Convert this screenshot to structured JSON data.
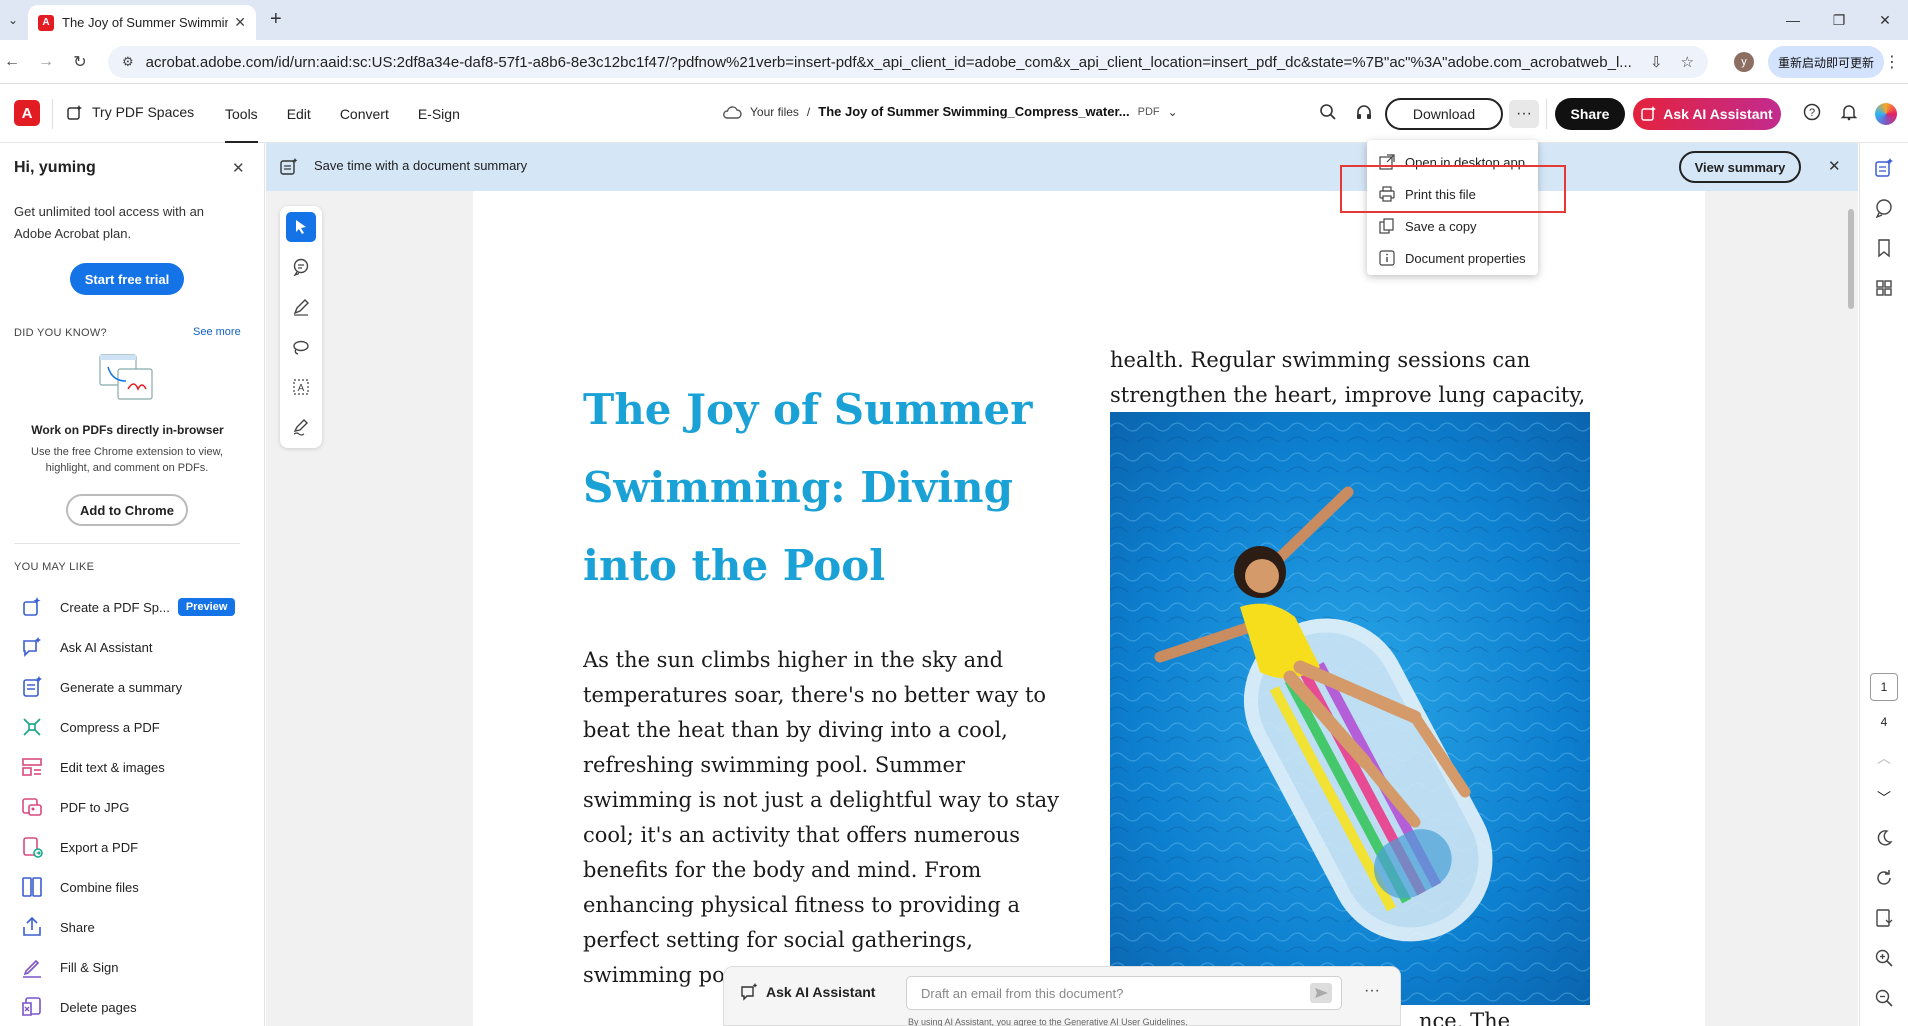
{
  "browser": {
    "tab_title": "The Joy of Summer Swimmin",
    "url": "acrobat.adobe.com/id/urn:aaid:sc:US:2df8a34e-daf8-57f1-a8b6-8e3c12bc1f47/?pdfnow%21verb=insert-pdf&x_api_client_id=adobe_com&x_api_client_location=insert_pdf_dc&state=%7B\"ac\"%3A\"adobe.com_acrobatweb_l...",
    "profile_initial": "y",
    "update_label": "重新启动即可更新"
  },
  "header": {
    "try_spaces": "Try PDF Spaces",
    "nav": [
      "Tools",
      "Edit",
      "Convert",
      "E-Sign"
    ],
    "breadcrumb_root": "Your files",
    "breadcrumb_sep": "/",
    "file_name": "The Joy of Summer Swimming_Compress_water...",
    "file_type": "PDF",
    "download_label": "Download",
    "share_label": "Share",
    "ai_label": "Ask AI Assistant"
  },
  "left_panel": {
    "greeting": "Hi, yuming",
    "description": "Get unlimited tool access with an Adobe Acrobat plan.",
    "trial_button": "Start free trial",
    "did_you_know": "DID YOU KNOW?",
    "see_more": "See more",
    "promo_title": "Work on PDFs directly in-browser",
    "promo_text": "Use the free Chrome extension to view, highlight, and comment on PDFs.",
    "chrome_button": "Add to Chrome",
    "you_may_like": "YOU MAY LIKE",
    "preview_badge": "Preview",
    "tools": [
      {
        "label": "Create a PDF Sp...",
        "icon": "create-spaces-icon"
      },
      {
        "label": "Ask AI Assistant",
        "icon": "ai-assistant-icon"
      },
      {
        "label": "Generate a summary",
        "icon": "summary-icon"
      },
      {
        "label": "Compress a PDF",
        "icon": "compress-icon"
      },
      {
        "label": "Edit text & images",
        "icon": "edit-text-icon"
      },
      {
        "label": "PDF to JPG",
        "icon": "pdf-to-jpg-icon"
      },
      {
        "label": "Export a PDF",
        "icon": "export-icon"
      },
      {
        "label": "Combine files",
        "icon": "combine-icon"
      },
      {
        "label": "Share",
        "icon": "share-icon"
      },
      {
        "label": "Fill & Sign",
        "icon": "fill-sign-icon"
      },
      {
        "label": "Delete pages",
        "icon": "delete-pages-icon"
      }
    ]
  },
  "banner": {
    "text": "Save time with a document summary",
    "button": "View summary"
  },
  "menu": {
    "items": [
      "Open in desktop app",
      "Print this file",
      "Save a copy",
      "Document properties"
    ]
  },
  "document": {
    "title": "The Joy of Summer Swimming: Diving into the Pool",
    "body": "As the sun climbs higher in the sky and temperatures soar, there's no better way to beat the heat than by diving into a cool, refreshing swimming pool. Summer swimming is not just a delightful way to stay cool; it's an activity that offers numerous benefits for the body and mind. From enhancing physical fitness to providing a perfect setting for social gatherings, swimming po",
    "right_top": "health. Regular swimming sessions can strengthen the heart, improve lung capacity,",
    "bottom_fragment": "nce. The"
  },
  "ai_bar": {
    "label": "Ask AI Assistant",
    "placeholder": "Draft an email from this document?",
    "terms": "By using AI Assistant, you agree to the Generative AI User Guidelines."
  },
  "pager": {
    "current": "1",
    "total": "4"
  },
  "colors": {
    "accent": "#1473e6",
    "title_blue": "#1aa1d6",
    "adobe_red": "#e31b23",
    "banner_bg": "#d5e6f7",
    "highlight_red": "#e53935"
  }
}
